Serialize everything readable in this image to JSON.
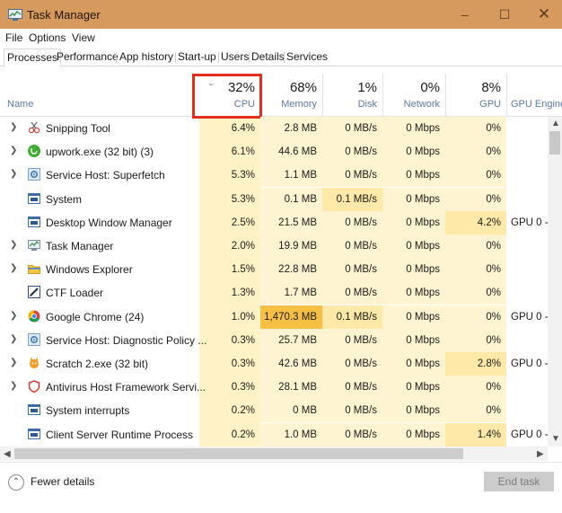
{
  "window": {
    "title": "Task Manager",
    "minimize_glyph": "–",
    "maximize_glyph": "☐",
    "close_glyph": "✕"
  },
  "menu": [
    "File",
    "Options",
    "View"
  ],
  "tabs": [
    "Processes",
    "Performance",
    "App history",
    "Start-up",
    "Users",
    "Details",
    "Services"
  ],
  "columns": {
    "name": "Name",
    "cpu": {
      "pct": "32%",
      "label": "CPU"
    },
    "memory": {
      "pct": "68%",
      "label": "Memory"
    },
    "disk": {
      "pct": "1%",
      "label": "Disk"
    },
    "network": {
      "pct": "0%",
      "label": "Network"
    },
    "gpu": {
      "pct": "8%",
      "label": "GPU"
    },
    "gpu_engine": {
      "label": "GPU Engine"
    }
  },
  "processes": [
    {
      "name": "Snipping Tool",
      "icon": "scissors-icon",
      "expandable": true,
      "cpu": "6.4%",
      "memory": "2.8 MB",
      "disk": "0 MB/s",
      "network": "0 Mbps",
      "gpu": "0%",
      "gpu_engine": ""
    },
    {
      "name": "upwork.exe (32 bit) (3)",
      "icon": "upwork-icon",
      "expandable": true,
      "cpu": "6.1%",
      "memory": "44.6 MB",
      "disk": "0 MB/s",
      "network": "0 Mbps",
      "gpu": "0%",
      "gpu_engine": ""
    },
    {
      "name": "Service Host: Superfetch",
      "icon": "gear-icon",
      "expandable": true,
      "cpu": "5.3%",
      "memory": "1.1 MB",
      "disk": "0 MB/s",
      "network": "0 Mbps",
      "gpu": "0%",
      "gpu_engine": ""
    },
    {
      "name": "System",
      "icon": "window-icon",
      "expandable": false,
      "cpu": "5.3%",
      "memory": "0.1 MB",
      "disk": "0.1 MB/s",
      "network": "0 Mbps",
      "gpu": "0%",
      "gpu_engine": ""
    },
    {
      "name": "Desktop Window Manager",
      "icon": "window-icon",
      "expandable": false,
      "cpu": "2.5%",
      "memory": "21.5 MB",
      "disk": "0 MB/s",
      "network": "0 Mbps",
      "gpu": "4.2%",
      "gpu_engine": "GPU 0 -"
    },
    {
      "name": "Task Manager",
      "icon": "task-manager-icon",
      "expandable": true,
      "cpu": "2.0%",
      "memory": "19.9 MB",
      "disk": "0 MB/s",
      "network": "0 Mbps",
      "gpu": "0%",
      "gpu_engine": ""
    },
    {
      "name": "Windows Explorer",
      "icon": "folder-icon",
      "expandable": true,
      "cpu": "1.5%",
      "memory": "22.8 MB",
      "disk": "0 MB/s",
      "network": "0 Mbps",
      "gpu": "0%",
      "gpu_engine": ""
    },
    {
      "name": "CTF Loader",
      "icon": "pen-icon",
      "expandable": false,
      "cpu": "1.3%",
      "memory": "1.7 MB",
      "disk": "0 MB/s",
      "network": "0 Mbps",
      "gpu": "0%",
      "gpu_engine": ""
    },
    {
      "name": "Google Chrome (24)",
      "icon": "chrome-icon",
      "expandable": true,
      "cpu": "1.0%",
      "memory": "1,470.3 MB",
      "disk": "0.1 MB/s",
      "network": "0 Mbps",
      "gpu": "0%",
      "gpu_engine": "GPU 0 -"
    },
    {
      "name": "Service Host: Diagnostic Policy ...",
      "icon": "gear-icon",
      "expandable": true,
      "cpu": "0.3%",
      "memory": "25.7 MB",
      "disk": "0 MB/s",
      "network": "0 Mbps",
      "gpu": "0%",
      "gpu_engine": ""
    },
    {
      "name": "Scratch 2.exe (32 bit)",
      "icon": "scratch-cat-icon",
      "expandable": true,
      "cpu": "0.3%",
      "memory": "42.6 MB",
      "disk": "0 MB/s",
      "network": "0 Mbps",
      "gpu": "2.8%",
      "gpu_engine": "GPU 0 -"
    },
    {
      "name": "Antivirus Host Framework Servi...",
      "icon": "shield-icon",
      "expandable": true,
      "cpu": "0.3%",
      "memory": "28.1 MB",
      "disk": "0 MB/s",
      "network": "0 Mbps",
      "gpu": "0%",
      "gpu_engine": ""
    },
    {
      "name": "System interrupts",
      "icon": "window-icon",
      "expandable": false,
      "cpu": "0.2%",
      "memory": "0 MB",
      "disk": "0 MB/s",
      "network": "0 Mbps",
      "gpu": "0%",
      "gpu_engine": ""
    },
    {
      "name": "Client Server Runtime Process",
      "icon": "window-icon",
      "expandable": false,
      "cpu": "0.2%",
      "memory": "1.0 MB",
      "disk": "0 MB/s",
      "network": "0 Mbps",
      "gpu": "1.4%",
      "gpu_engine": "GPU 0 -"
    }
  ],
  "footer": {
    "fewer_details": "Fewer details",
    "end_task": "End task"
  },
  "colors": {
    "titlebar": "#d69a5e",
    "highlight_box": "#e0301e",
    "heat_light": "#fff4d1",
    "heat_medium": "#ffe9a8",
    "heat_strong": "#f7c043"
  }
}
